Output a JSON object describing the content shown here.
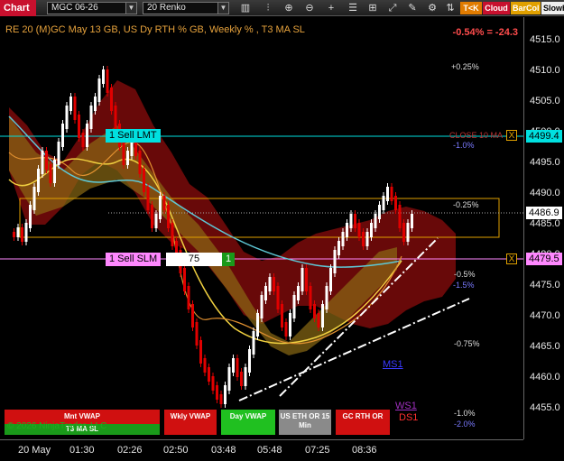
{
  "toolbar": {
    "chart_tab": "Chart",
    "instrument": "MGC 06-26",
    "bar_type": "20 Renko",
    "pills": {
      "tk": "T<K",
      "cloud": "Cloud",
      "barcol": "BarCol",
      "slowh": "SlowH"
    }
  },
  "chart": {
    "title": "RE 20  (M)GC May 13 GB, US Dy RTH % GB, Weekly % , T3 MA SL",
    "change": "-0.54% = -24.3",
    "pct_labels": {
      "p025_top": "+0.25%",
      "close_ma": "CLOSE 10 MA",
      "m1_top": "-1.0%",
      "m025": "-0.25%",
      "m05": "-0.5%",
      "m15": "-1.5%",
      "m075": "-0.75%",
      "m1_bot": "-1.0%",
      "m2": "-2.0%"
    },
    "markers": {
      "ms1": "MS1",
      "ws1": "WS1",
      "ds1": "DS1"
    },
    "orders": {
      "sell_lmt": "1 Sell LMT",
      "sell_slm": "1 Sell SLM",
      "slm_qty": "75",
      "slm_count": "1",
      "close_x": "X"
    },
    "copyright": "© 2026 NinjaTrader, LLC"
  },
  "price_axis": {
    "ticks": [
      "4515.0",
      "4510.0",
      "4505.0",
      "4500.0",
      "4495.0",
      "4490.0",
      "4485.0",
      "4480.0",
      "4475.0",
      "4470.0",
      "4465.0",
      "4460.0",
      "4455.0"
    ],
    "tag_lmt": "4499.4",
    "tag_current": "4486.9",
    "tag_slm": "4479.5"
  },
  "time_axis": {
    "labels": [
      "20 May",
      "01:30",
      "02:26",
      "02:50",
      "03:48",
      "05:48",
      "07:25",
      "08:36"
    ]
  },
  "buttons": {
    "mnt_vwap": "Mnt VWAP",
    "t3_ma_sl": "T3 MA SL",
    "wkly_vwap": "Wkly VWAP",
    "day_vwap": "Day VWAP",
    "us_eth": "US ETH OR 15 Min",
    "gc_rth": "GC RTH OR"
  },
  "colors": {
    "sell_lmt": "#00e0e0",
    "sell_slm": "#ff88ff",
    "bull_bar": "#ffffff",
    "bear_bar": "#e00000",
    "cloud_red": "#8b0000",
    "cloud_gold": "#8b6914"
  }
}
